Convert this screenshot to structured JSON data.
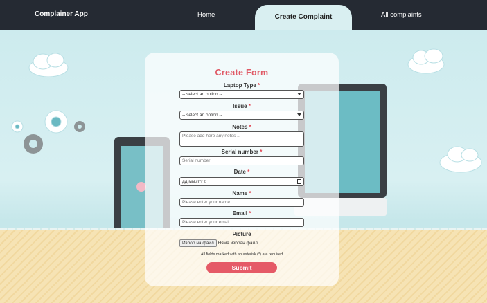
{
  "navbar": {
    "brand": "Complainer App",
    "home": "Home",
    "create": "Create Complaint",
    "all": "All complaints"
  },
  "form": {
    "title": "Create Form",
    "laptop_type_label": "Laptop Type",
    "laptop_type_value": "-- select an option --",
    "issue_label": "Issue",
    "issue_value": "-- select an option --",
    "notes_label": "Notes",
    "notes_placeholder": "Please add here any notes ...",
    "serial_label": "Serial number",
    "serial_placeholder": "Serial number",
    "date_label": "Date",
    "date_value": "дд.мм.гггг г.",
    "name_label": "Name",
    "name_placeholder": "Please enter your name ...",
    "email_label": "Email",
    "email_placeholder": "Please enter your email ...",
    "picture_label": "Picture",
    "file_button": "Избор на файл",
    "file_status": "Няма избран файл",
    "required_note": "All fields marked with an asterisk (*) are required",
    "required_mark": "*",
    "submit": "Submit"
  },
  "colors": {
    "navbar": "#252a33",
    "accent": "#e55a67",
    "sky": "#d4eef0"
  }
}
